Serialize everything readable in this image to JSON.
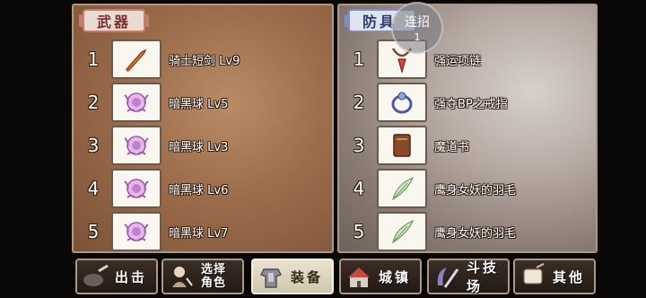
{
  "weapons": {
    "title": "武器",
    "items": [
      {
        "num": "1",
        "name": "骑士短剑 Lv9",
        "icon": "dagger-icon"
      },
      {
        "num": "2",
        "name": "暗黑球 Lv5",
        "icon": "dark-orb-icon"
      },
      {
        "num": "3",
        "name": "暗黑球 Lv3",
        "icon": "dark-orb-icon"
      },
      {
        "num": "4",
        "name": "暗黑球 Lv6",
        "icon": "dark-orb-icon"
      },
      {
        "num": "5",
        "name": "暗黑球 Lv7",
        "icon": "dark-orb-icon"
      }
    ]
  },
  "armor": {
    "title": "防具",
    "items": [
      {
        "num": "1",
        "name": "强运项链",
        "icon": "necklace-icon"
      },
      {
        "num": "2",
        "name": "强夺BP之戒指",
        "icon": "ring-icon"
      },
      {
        "num": "3",
        "name": "魔道书",
        "icon": "book-icon"
      },
      {
        "num": "4",
        "name": "鹰身女妖的羽毛",
        "icon": "feather-icon"
      },
      {
        "num": "5",
        "name": "鹰身女妖的羽毛",
        "icon": "feather-icon"
      }
    ]
  },
  "combo": {
    "label": "连招",
    "count": "1"
  },
  "menu": [
    {
      "label": "出击",
      "icon": "sortie-icon"
    },
    {
      "label_line1": "选择",
      "label_line2": "角色",
      "icon": "character-icon"
    },
    {
      "label": "装备",
      "icon": "armor-icon",
      "active": true
    },
    {
      "label": "城镇",
      "icon": "town-icon"
    },
    {
      "label": "斗技场",
      "icon": "arena-icon"
    },
    {
      "label": "其他",
      "icon": "scroll-icon"
    }
  ]
}
